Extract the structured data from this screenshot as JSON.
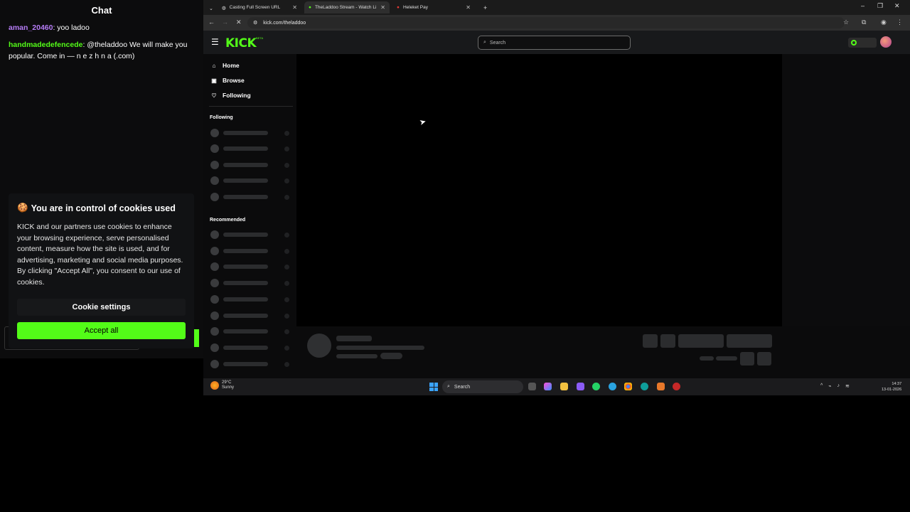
{
  "chat": {
    "title": "Chat",
    "messages": [
      {
        "user": "aman_20460",
        "user_color": "#b57cf5",
        "text": ": yoo ladoo"
      },
      {
        "user": "handmadedefencede",
        "user_color": "#53fc18",
        "text": ": @theladdoo We will make you popular. Come in — n e z h n a (.com)"
      }
    ]
  },
  "cookie_banner": {
    "title": "You are in control of cookies used",
    "body": "KICK and our partners use cookies to enhance your browsing experience, serve personalised content, measure how the site is used, and for advertising, marketing and social media purposes. By clicking \"Accept All\", you consent to our use of cookies.",
    "settings_label": "Cookie settings",
    "accept_label": "Accept all"
  },
  "browser": {
    "tabs": [
      {
        "label": "Casting Full Screen URL"
      },
      {
        "label": "TheLaddoo Stream - Watch Liv"
      },
      {
        "label": "Heleket Pay"
      }
    ],
    "new_tab": "+",
    "url": "kick.com/theladdoo"
  },
  "kick": {
    "logo": "KICK",
    "logo_badge": "BETA",
    "search_placeholder": "Search",
    "nav": [
      {
        "label": "Home",
        "icon": "home-icon"
      },
      {
        "label": "Browse",
        "icon": "browse-icon"
      },
      {
        "label": "Following",
        "icon": "heart-icon"
      }
    ],
    "sections": {
      "following": "Following",
      "recommended": "Recommended"
    },
    "colors": {
      "brand": "#53fc18",
      "background": "#0b0b0c"
    }
  },
  "taskbar": {
    "weather_temp": "29°C",
    "weather_desc": "Sunny",
    "search_label": "Search",
    "time": "14:37",
    "date": "13-01-2026"
  }
}
